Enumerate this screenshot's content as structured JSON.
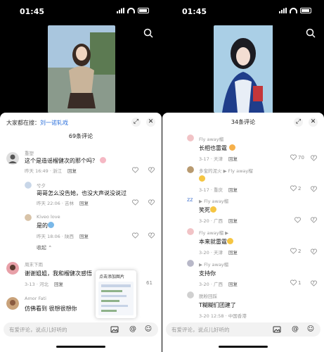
{
  "left": {
    "status": {
      "time": "01:45"
    },
    "panel": {
      "hot_prefix": "大家都在搜：",
      "hot_term": "刘一诺轧戏",
      "count": "69条评论"
    },
    "comments": [
      {
        "name": "重塑",
        "text": "这个是造谣榴健次的那个吗？",
        "meta": "昨天 16:49 · 浙江",
        "reply": "回复",
        "likes": ""
      },
      {
        "name": "兮夕",
        "text": "哥哥怎么没告她，也没大声说没说过",
        "meta": "昨天 22:06 · 吉林",
        "reply": "回复",
        "likes": ""
      },
      {
        "name": "Kiveo love",
        "text": "是的",
        "meta": "昨天 18:06 · 陕西",
        "reply": "回复",
        "likes": ""
      },
      {
        "name": "周末下雨",
        "text": "谢谢姐姐，我和榴健次感悟",
        "meta": "3-13 · 河北",
        "reply": "回复",
        "likes": "61"
      },
      {
        "name": "Amor Fati",
        "text": "仿佛看到 很想很想你",
        "meta": "",
        "reply": "",
        "likes": ""
      }
    ],
    "collapse": "收起",
    "popup_title": "点击添加图片",
    "input_placeholder": "有爱评论，说点儿好听的"
  },
  "right": {
    "status": {
      "time": "01:45"
    },
    "panel": {
      "count": "34条评论"
    },
    "comments": [
      {
        "name": "Fly away榴",
        "text": "长相也雷霆",
        "meta": "3-17 · 天津",
        "reply": "回复",
        "likes": "70"
      },
      {
        "name": "多宝的泥火 ▶ Fly away榴",
        "text": "",
        "meta": "3-17 · 重庆",
        "reply": "回复",
        "likes": "2"
      },
      {
        "name": "▶ Fly away榴",
        "text": "笑死",
        "meta": "3-20 · 广西",
        "reply": "回复",
        "likes": ""
      },
      {
        "name": "Fly away榴 ▶",
        "text": "本来就雷霆",
        "meta": "3-20 · 天津",
        "reply": "回复",
        "likes": "2"
      },
      {
        "name": "▶ Fly away榴",
        "text": "支持你",
        "meta": "3-20 · 广西",
        "reply": "回复",
        "likes": "1"
      },
      {
        "name": "脱粉回踩",
        "text": "T糊糊们团建了",
        "meta": "3-20 12:58 · 中国香港",
        "reply": "",
        "likes": ""
      }
    ],
    "input_placeholder": "有爱评论，说点儿好听的"
  },
  "colors": {
    "link": "#2a6fdb",
    "panel": "#ffffff",
    "input": "#f2f2f2"
  }
}
